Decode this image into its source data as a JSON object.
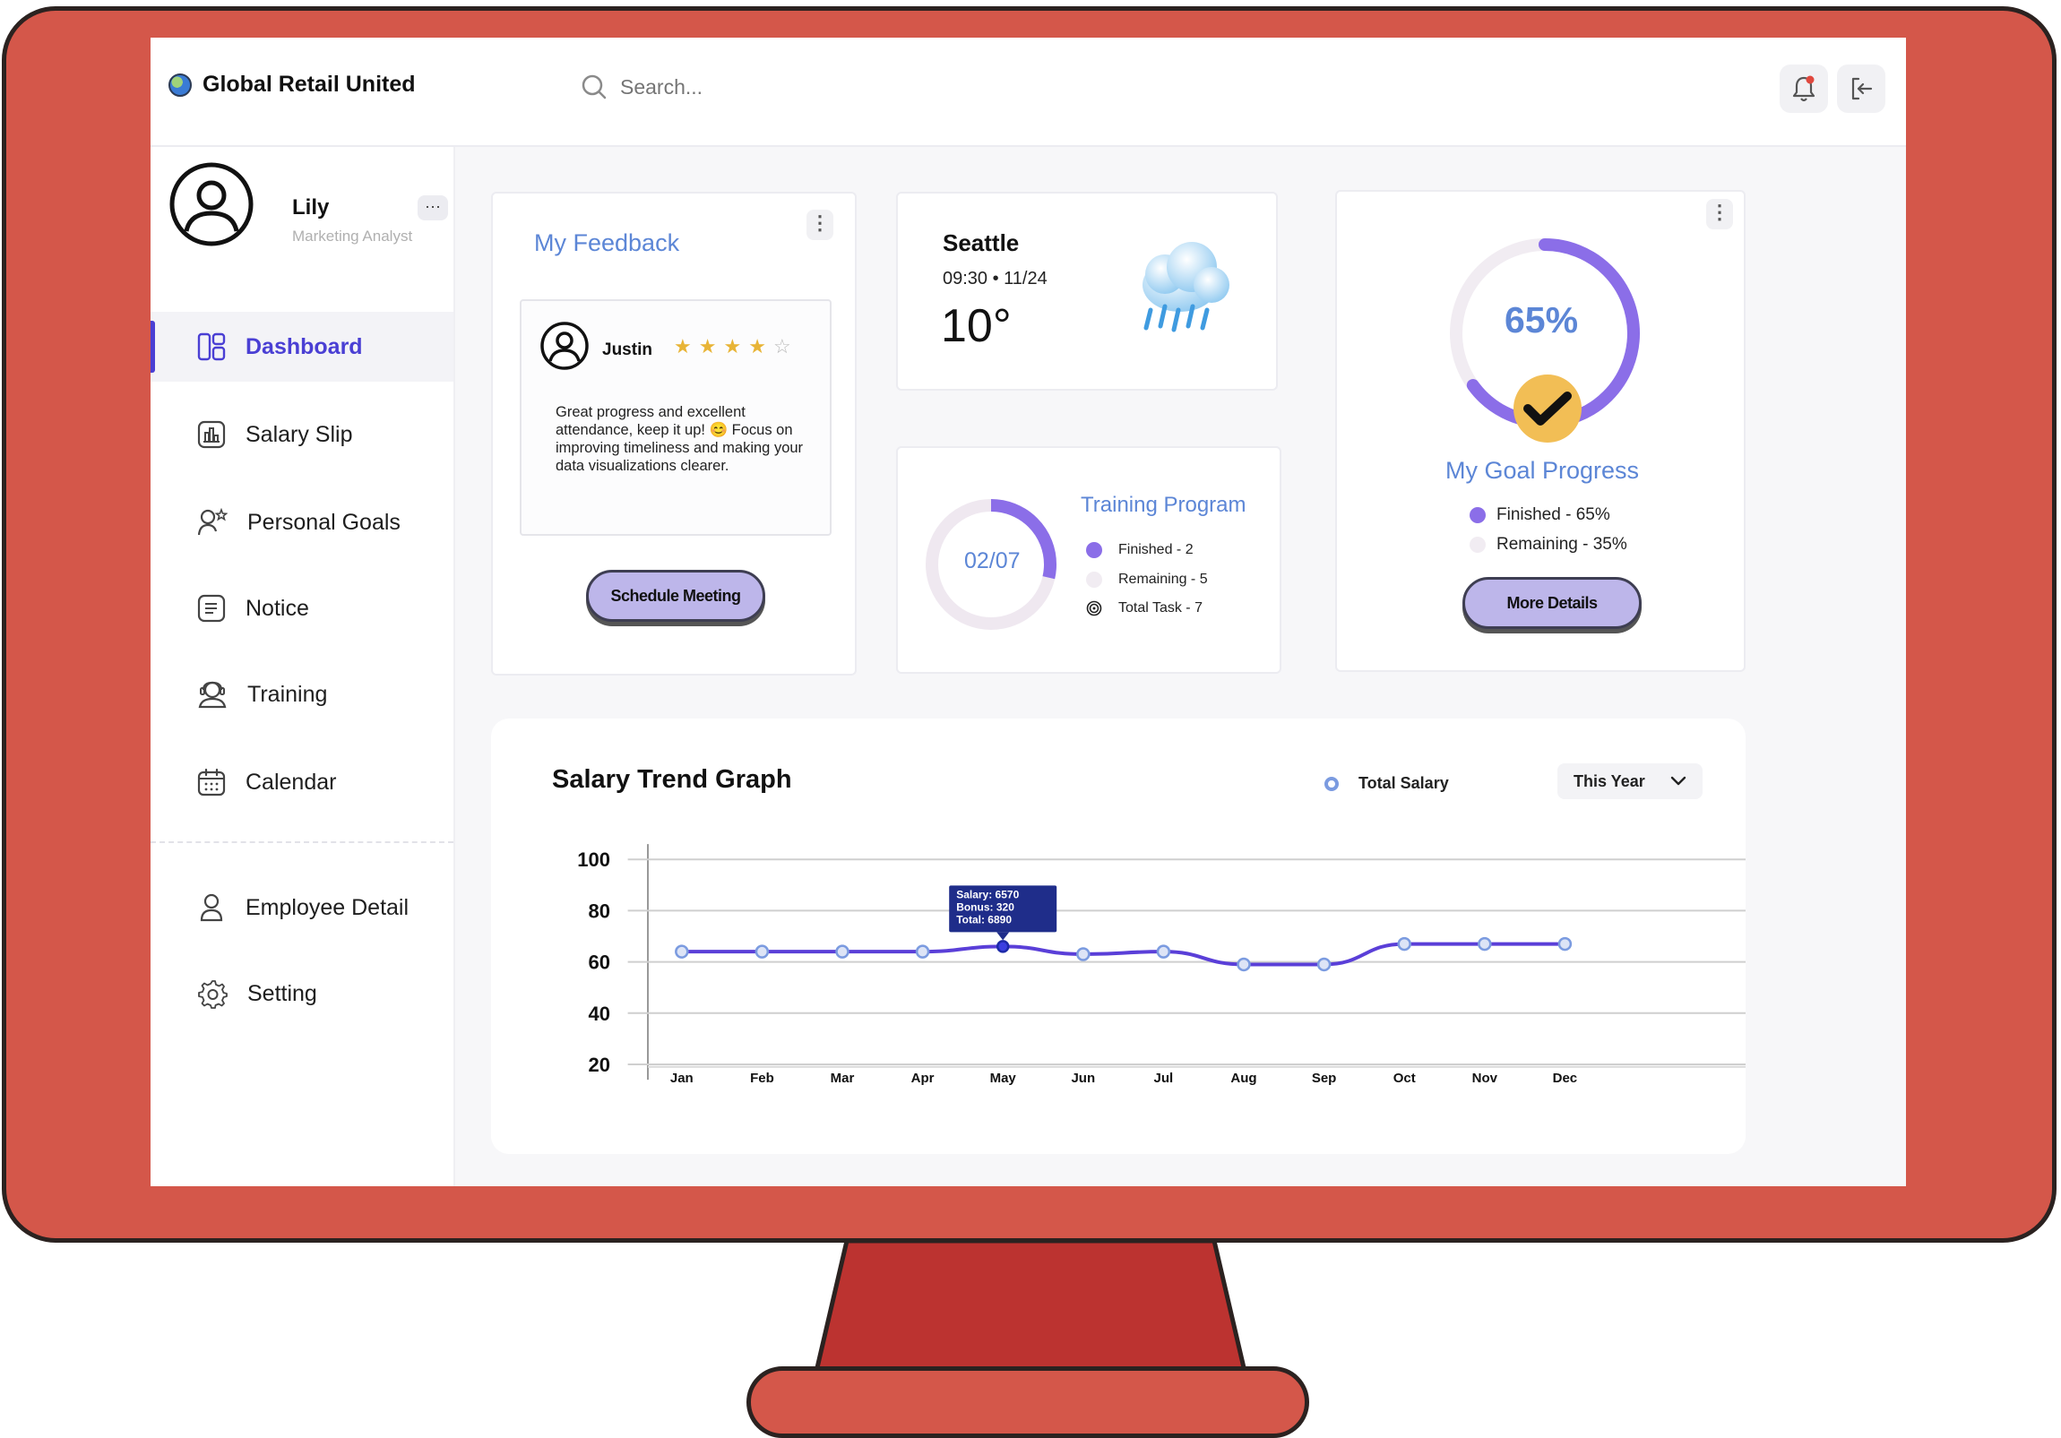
{
  "brand": {
    "name": "Global Retail United"
  },
  "search": {
    "placeholder": "Search..."
  },
  "user": {
    "name": "Lily",
    "role": "Marketing Analyst",
    "more": "···"
  },
  "sidebar": {
    "items": [
      {
        "label": "Dashboard",
        "icon": "dashboard-icon",
        "active": true
      },
      {
        "label": "Salary Slip",
        "icon": "salary-slip-icon"
      },
      {
        "label": "Personal Goals",
        "icon": "personal-goals-icon"
      },
      {
        "label": "Notice",
        "icon": "notice-icon"
      },
      {
        "label": "Training",
        "icon": "training-icon"
      },
      {
        "label": "Calendar",
        "icon": "calendar-icon"
      }
    ],
    "secondary": [
      {
        "label": "Employee Detail",
        "icon": "user-icon"
      },
      {
        "label": "Setting",
        "icon": "gear-icon"
      }
    ]
  },
  "feedback": {
    "title": "My Feedback",
    "author": "Justin",
    "rating": 4,
    "rating_max": 5,
    "text": "Great progress and excellent attendance, keep it up! 😊  Focus on improving timeliness and making your data visualizations clearer.",
    "button": "Schedule Meeting"
  },
  "weather": {
    "city": "Seattle",
    "time": "09:30 • 11/24",
    "temp": "10°",
    "icon": "rain-cloud-icon"
  },
  "training": {
    "title": "Training Program",
    "progress_label": "02/07",
    "finished": "Finished - 2",
    "remaining": "Remaining - 5",
    "total": "Total Task - 7",
    "progress_fraction": 0.2857
  },
  "goal": {
    "percent_label": "65%",
    "progress_fraction": 0.65,
    "title": "My Goal Progress",
    "finished": "Finished - 65%",
    "remaining": "Remaining - 35%",
    "button": "More Details"
  },
  "colors": {
    "accent": "#4a3fd4",
    "purple": "#8b6ee8",
    "light_track": "#efe8f0",
    "title_blue": "#5c86d6",
    "line": "#5a3fd8",
    "point": "#7b9be0",
    "check_badge": "#f2be55"
  },
  "chart_data": {
    "type": "line",
    "title": "Salary Trend Graph",
    "series": [
      {
        "name": "Total Salary",
        "values": [
          64,
          64,
          64,
          64,
          66,
          63,
          64,
          59,
          59,
          67,
          67,
          67
        ]
      }
    ],
    "categories": [
      "Jan",
      "Feb",
      "Mar",
      "Apr",
      "May",
      "Jun",
      "Jul",
      "Aug",
      "Sep",
      "Oct",
      "Nov",
      "Dec"
    ],
    "y_ticks": [
      100,
      80,
      60,
      40,
      20
    ],
    "ylim": [
      20,
      100
    ],
    "grid": true,
    "legend": "top-right",
    "period": "This Year",
    "tooltip": {
      "index": 4,
      "lines": [
        "Salary: 6570",
        "Bonus: 320",
        "Total: 6890"
      ]
    }
  }
}
